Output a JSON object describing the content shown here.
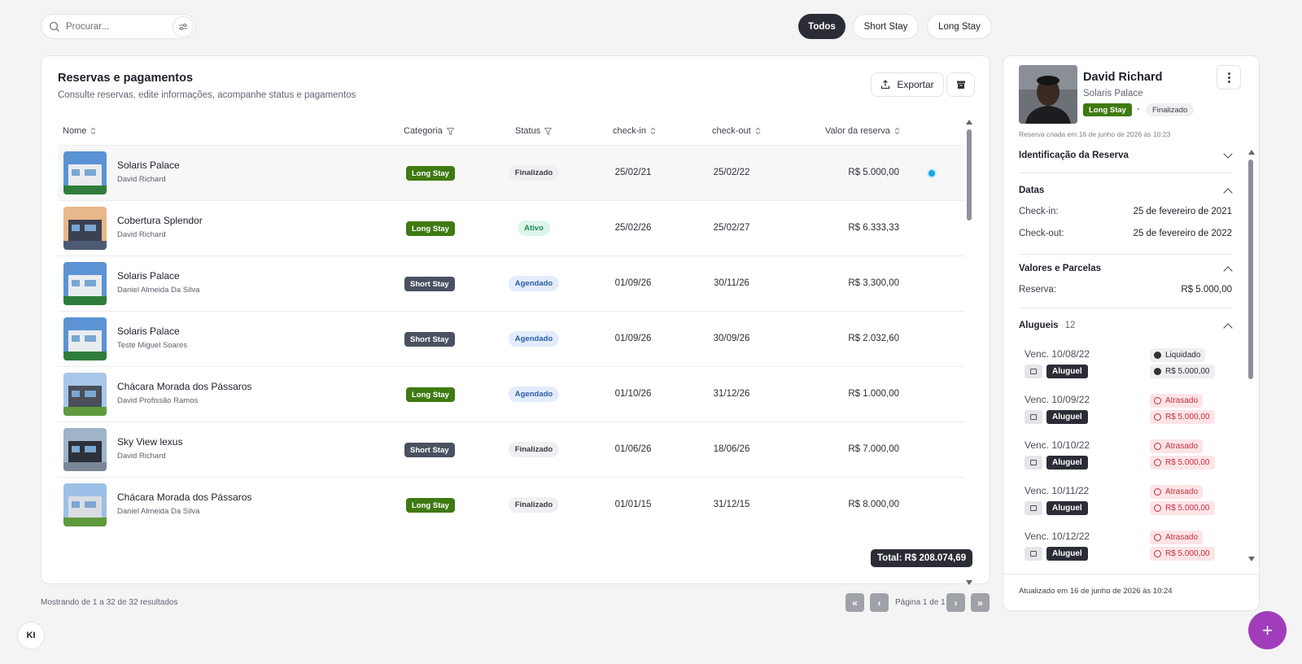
{
  "search": {
    "placeholder": "Procurar..."
  },
  "filters": {
    "items": [
      "Todos",
      "Short Stay",
      "Long Stay"
    ],
    "active": "Todos"
  },
  "card": {
    "title": "Reservas e pagamentos",
    "subtitle": "Consulte reservas, edite informações, acompanhe status e pagamentos",
    "export_label": "Exportar"
  },
  "table": {
    "headers": {
      "nome": "Nome",
      "categoria": "Categoria",
      "status": "Status",
      "checkin": "check-in",
      "checkout": "check-out",
      "valor": "Valor da reserva"
    },
    "rows": [
      {
        "name": "Solaris Palace",
        "guest": "David Richard",
        "category": "Long Stay",
        "status": "Finalizado",
        "checkin": "25/02/21",
        "checkout": "25/02/22",
        "value": "R$ 5.000,00"
      },
      {
        "name": "Cobertura Splendor",
        "guest": "David Richard",
        "category": "Long Stay",
        "status": "Ativo",
        "checkin": "25/02/26",
        "checkout": "25/02/27",
        "value": "R$ 6.333,33"
      },
      {
        "name": "Solaris Palace",
        "guest": "Daniel Almeida Da Silva",
        "category": "Short Stay",
        "status": "Agendado",
        "checkin": "01/09/26",
        "checkout": "30/11/26",
        "value": "R$ 3.300,00"
      },
      {
        "name": "Solaris Palace",
        "guest": "Teste Miguel Soares",
        "category": "Short Stay",
        "status": "Agendado",
        "checkin": "01/09/26",
        "checkout": "30/09/26",
        "value": "R$ 2.032,60"
      },
      {
        "name": "Chácara Morada dos Pássaros",
        "guest": "David Profissão Ramos",
        "category": "Long Stay",
        "status": "Agendado",
        "checkin": "01/10/26",
        "checkout": "31/12/26",
        "value": "R$ 1.000,00"
      },
      {
        "name": "Sky View lexus",
        "guest": "David Richard",
        "category": "Short Stay",
        "status": "Finalizado",
        "checkin": "01/06/26",
        "checkout": "18/06/26",
        "value": "R$ 7.000,00"
      },
      {
        "name": "Chácara Morada dos Pássaros",
        "guest": "Daniel Almeida Da Silva",
        "category": "Long Stay",
        "status": "Finalizado",
        "checkin": "01/01/15",
        "checkout": "31/12/15",
        "value": "R$ 8.000,00"
      }
    ],
    "total": "Total: R$ 208.074,69"
  },
  "footer": {
    "results": "Mostrando de 1 a 32 de 32 resultados",
    "page": "Página 1 de 1"
  },
  "panel": {
    "name": "David Richard",
    "property": "Solaris Palace",
    "category": "Long Stay",
    "dash": "-",
    "status": "Finalizado",
    "created": "Reserva criada em 16 de junho de 2026 às 10:23",
    "sections": {
      "identificacao": "Identificação da Reserva",
      "datas": "Datas",
      "valores": "Valores e Parcelas",
      "alugueis": "Alugueis",
      "alugueis_count": "12"
    },
    "checkin_label": "Check-in:",
    "checkin_value": "25 de fevereiro de 2021",
    "checkout_label": "Check-out:",
    "checkout_value": "25 de fevereiro de 2022",
    "reserva_label": "Reserva:",
    "reserva_value": "R$ 5.000,00",
    "rents": [
      {
        "venc": "Venc. 10/08/22",
        "type": "Aluguel",
        "status": "Liquidado",
        "amount": "R$ 5.000,00",
        "state": "ok"
      },
      {
        "venc": "Venc. 10/09/22",
        "type": "Aluguel",
        "status": "Atrasado",
        "amount": "R$ 5.000,00",
        "state": "late"
      },
      {
        "venc": "Venc. 10/10/22",
        "type": "Aluguel",
        "status": "Atrasado",
        "amount": "R$ 5.000,00",
        "state": "late"
      },
      {
        "venc": "Venc. 10/11/22",
        "type": "Aluguel",
        "status": "Atrasado",
        "amount": "R$ 5.000,00",
        "state": "late"
      },
      {
        "venc": "Venc. 10/12/22",
        "type": "Aluguel",
        "status": "Atrasado",
        "amount": "R$ 5.000,00",
        "state": "late"
      }
    ],
    "updated": "Atualizado em 16 de junho de 2026 às 10:24"
  },
  "fab_label": "+",
  "logo_text": "KI",
  "colors": {
    "long_stay": "#3f7a12",
    "short_stay": "#4a5260",
    "fab": "#a13dbb",
    "selected_dot": "#1aa3e8",
    "late": "#c2303f"
  },
  "icons": [
    "search-icon",
    "sliders-icon",
    "upload-icon",
    "archive-icon",
    "filter-icon",
    "sort-icon",
    "more-vertical-icon",
    "chevron-icon",
    "receipt-icon",
    "check-circle-icon",
    "clock-icon",
    "double-chevron-left-icon",
    "chevron-left-icon",
    "chevron-right-icon",
    "double-chevron-right-icon",
    "plus-icon"
  ]
}
